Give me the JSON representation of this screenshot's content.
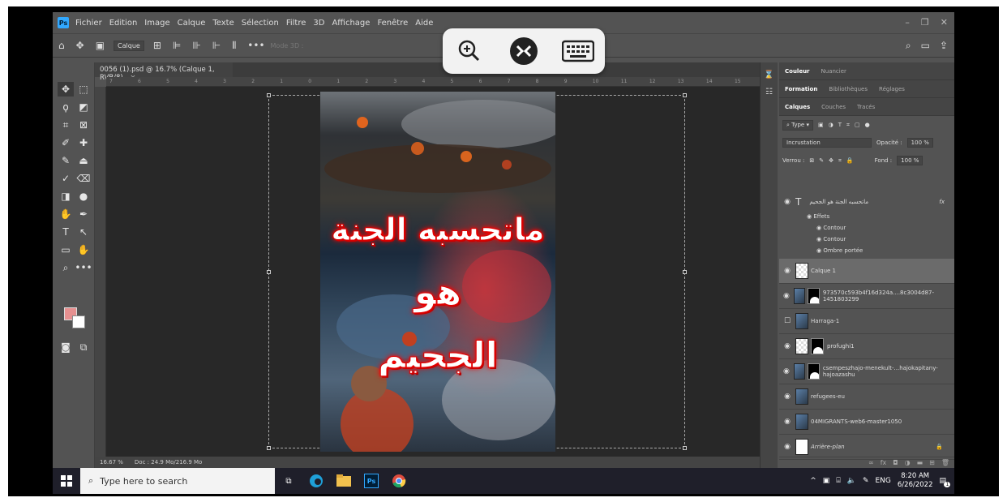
{
  "menubar": {
    "items": [
      "Fichier",
      "Edition",
      "Image",
      "Calque",
      "Texte",
      "Sélection",
      "Filtre",
      "3D",
      "Affichage",
      "Fenêtre",
      "Aide"
    ]
  },
  "options": {
    "layer_select": "Calque",
    "mode3d": "Mode 3D :"
  },
  "document": {
    "tab_title": "0056 (1).psd @ 16.7% (Calque 1, RVB/8)",
    "zoom": "16.67 %",
    "doc_info": "Doc : 24.9 Mo/216.9 Mo",
    "ruler_ticks": [
      "7",
      "6",
      "5",
      "4",
      "3",
      "2",
      "1",
      "0",
      "1",
      "2",
      "3",
      "4",
      "5",
      "6",
      "7",
      "8",
      "9",
      "10",
      "11",
      "12",
      "13",
      "14",
      "15"
    ]
  },
  "artwork": {
    "line1": "ماتحسبه الجنة",
    "line2": "هو",
    "line3": "الجحيم"
  },
  "panels": {
    "top_tabs": [
      "Couleur",
      "Nuancier"
    ],
    "mid_tabs": [
      "Formation",
      "Bibliothèques",
      "Réglages"
    ],
    "layer_tabs": [
      "Calques",
      "Couches",
      "Tracés"
    ],
    "filter": "Type",
    "blend_mode": "Incrustation",
    "opacity_label": "Opacité :",
    "opacity": "100 %",
    "lock_label": "Verrou :",
    "fill_label": "Fond :",
    "fill": "100 %"
  },
  "layers": {
    "text_layer": "ماتحسبه الجنة هو الجحيم",
    "effects_label": "Effets",
    "effects": [
      "Contour",
      "Contour",
      "Ombre portée"
    ],
    "rows": [
      "Calque 1",
      "973570c593b4f16d324a....8c3004d87-1451803299",
      "Harraga-1",
      "profughi1",
      "csempeszhajo-menekult-...hajokapitany-hajoazashu",
      "refugees-eu",
      "04MIGRANTS-web6-master1050",
      "Arrière-plan"
    ]
  },
  "taskbar": {
    "search_placeholder": "Type here to search",
    "language": "ENG",
    "time": "8:20 AM",
    "date": "6/26/2022",
    "notification_count": "1"
  },
  "colors": {
    "foreground": "#e69090",
    "background": "#ffffff",
    "ps_accent": "#31a8ff",
    "text_glow": "#e10000"
  }
}
